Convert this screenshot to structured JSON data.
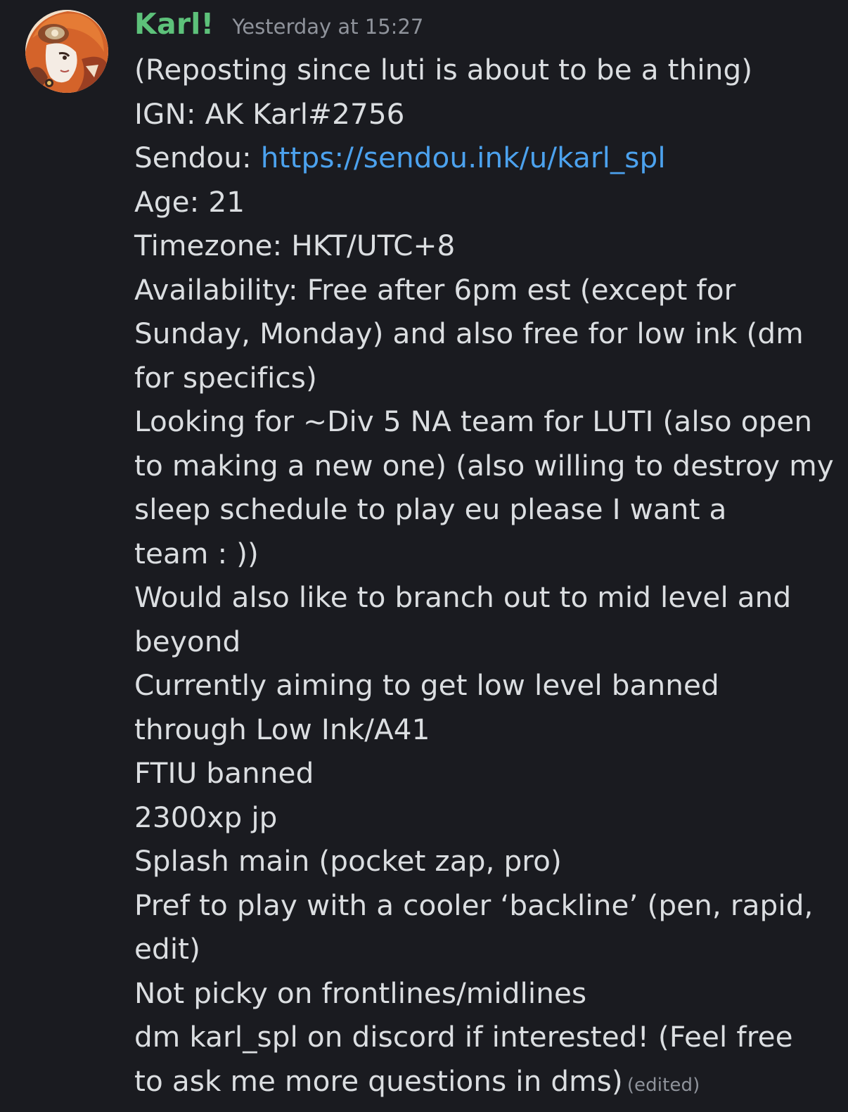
{
  "author": {
    "name": "Karl!",
    "avatar_icon": "avatar-icon",
    "name_color": "#5dc17a"
  },
  "timestamp": "Yesterday at 15:27",
  "link_color": "#4ca2ee",
  "lines": {
    "l1": "(Reposting since luti is about to be a thing)",
    "l2": "IGN: AK Karl#2756",
    "l3_prefix": "Sendou: ",
    "l3_link": "https://sendou.ink/u/karl_spl",
    "l4": "Age: 21",
    "l5": "Timezone: HKT/UTC+8",
    "l6": "Availability: Free after 6pm est (except for",
    "l7": "Sunday, Monday) and also free for low ink (dm",
    "l8": "for specifics)",
    "l9": "Looking for ~Div 5 NA team for LUTI (also open",
    "l10": "to making a new one) (also willing to destroy my",
    "l11": "sleep schedule to play eu please I want a",
    "l12": "team : ))",
    "l13": "Would also like to branch out to mid level and",
    "l14": "beyond",
    "l15": "Currently aiming to get low level banned",
    "l16": "through Low Ink/A41",
    "l17": "FTIU banned",
    "l18": "2300xp jp",
    "l19": "Splash main (pocket zap, pro)",
    "l20": "Pref to play with a cooler ‘backline’ (pen, rapid,",
    "l21": "edit)",
    "l22": "Not picky on frontlines/midlines",
    "l23": "dm karl_spl on discord if interested! (Feel free",
    "l24": "to ask me more questions in dms)"
  },
  "edited_label": "(edited)"
}
